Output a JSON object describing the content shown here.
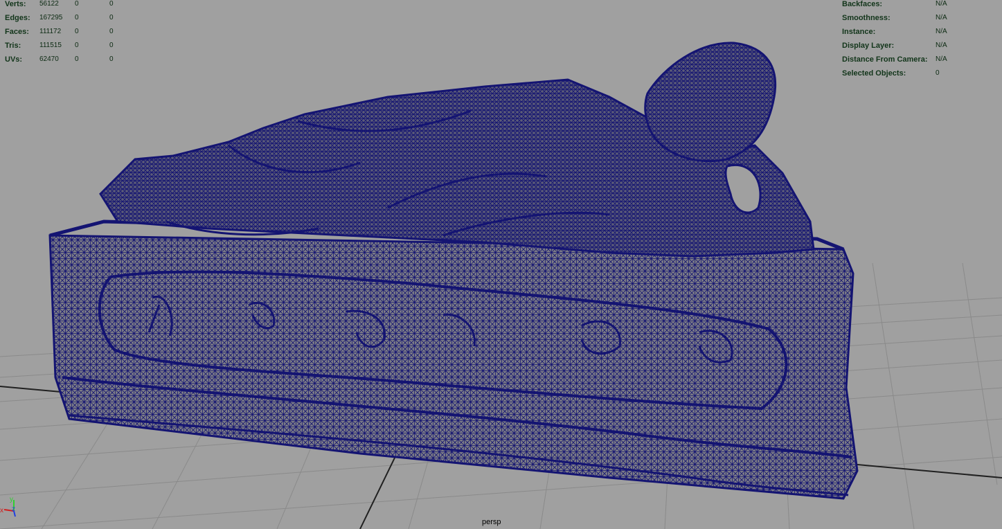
{
  "viewport": {
    "camera_label": "persp",
    "background_color": "#a0a0a0",
    "wireframe_color": "#141472",
    "model": "reclining-figure-sculpture-wireframe-mesh"
  },
  "hud_left": {
    "rows": [
      {
        "label": "Verts:",
        "v1": "56122",
        "v2": "0",
        "v3": "0"
      },
      {
        "label": "Edges:",
        "v1": "167295",
        "v2": "0",
        "v3": "0"
      },
      {
        "label": "Faces:",
        "v1": "111172",
        "v2": "0",
        "v3": "0"
      },
      {
        "label": "Tris:",
        "v1": "111515",
        "v2": "0",
        "v3": "0"
      },
      {
        "label": "UVs:",
        "v1": "62470",
        "v2": "0",
        "v3": "0"
      }
    ]
  },
  "hud_right": {
    "rows": [
      {
        "label": "Backfaces:",
        "value": "N/A"
      },
      {
        "label": "Smoothness:",
        "value": "N/A"
      },
      {
        "label": "Instance:",
        "value": "N/A"
      },
      {
        "label": "Display Layer:",
        "value": "N/A"
      },
      {
        "label": "Distance From Camera:",
        "value": "N/A"
      },
      {
        "label": "Selected Objects:",
        "value": "0"
      }
    ]
  },
  "axis_gizmo": {
    "x": "x",
    "y": "y",
    "z": "z"
  }
}
